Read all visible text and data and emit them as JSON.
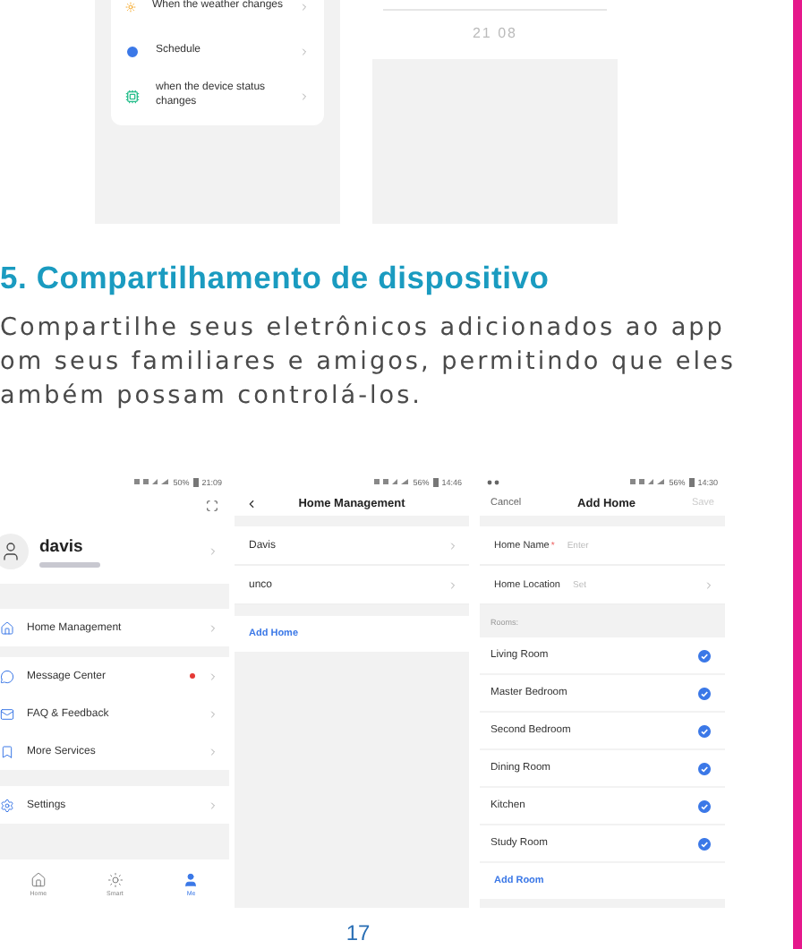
{
  "top_screens": {
    "conditions": [
      {
        "kind": "weather",
        "label": "When the weather changes"
      },
      {
        "kind": "schedule",
        "label": "Schedule"
      },
      {
        "kind": "device",
        "label": "when the device status changes"
      }
    ],
    "time_picker": {
      "rows": [
        {
          "hour": "21",
          "minute": "08"
        }
      ]
    }
  },
  "section": {
    "heading": "5. Compartilhamento de dispositivo",
    "lines": [
      "Compartilhe seus eletrônicos adicionados ao app",
      "om seus familiares e amigos, permitindo que eles",
      "ambém possam controlá-los."
    ]
  },
  "profile_screen": {
    "status": {
      "battery": "50%",
      "time": "21:09"
    },
    "user": {
      "name": "davis"
    },
    "groups": [
      [
        {
          "kind": "home",
          "label": "Home Management",
          "unread": false
        }
      ],
      [
        {
          "kind": "message",
          "label": "Message Center",
          "unread": true
        },
        {
          "kind": "faq",
          "label": "FAQ & Feedback",
          "unread": false
        },
        {
          "kind": "services",
          "label": "More Services",
          "unread": false
        }
      ],
      [
        {
          "kind": "settings",
          "label": "Settings",
          "unread": false
        }
      ]
    ],
    "tabs": [
      {
        "kind": "home",
        "label": "Home",
        "selected": false
      },
      {
        "kind": "smart",
        "label": "Smart",
        "selected": false
      },
      {
        "kind": "me",
        "label": "Me",
        "selected": true
      }
    ]
  },
  "homes_screen": {
    "status": {
      "battery": "56%",
      "time": "14:46"
    },
    "title": "Home Management",
    "homes": [
      "Davis",
      "unco"
    ],
    "add_button": "Add Home"
  },
  "add_home_screen": {
    "status": {
      "battery": "56%",
      "time": "14:30"
    },
    "cancel": "Cancel",
    "title": "Add Home",
    "save": "Save",
    "fields": [
      {
        "label": "Home Name",
        "required_mark": "*",
        "placeholder": "Enter",
        "chevron": false
      },
      {
        "label": "Home Location",
        "placeholder": "Set",
        "chevron": true
      }
    ],
    "rooms_label": "Rooms:",
    "rooms": [
      {
        "name": "Living Room",
        "checked": true
      },
      {
        "name": "Master Bedroom",
        "checked": true
      },
      {
        "name": "Second Bedroom",
        "checked": true
      },
      {
        "name": "Dining Room",
        "checked": true
      },
      {
        "name": "Kitchen",
        "checked": true
      },
      {
        "name": "Study Room",
        "checked": true
      }
    ],
    "add_room": "Add Room"
  },
  "page_number": "17"
}
